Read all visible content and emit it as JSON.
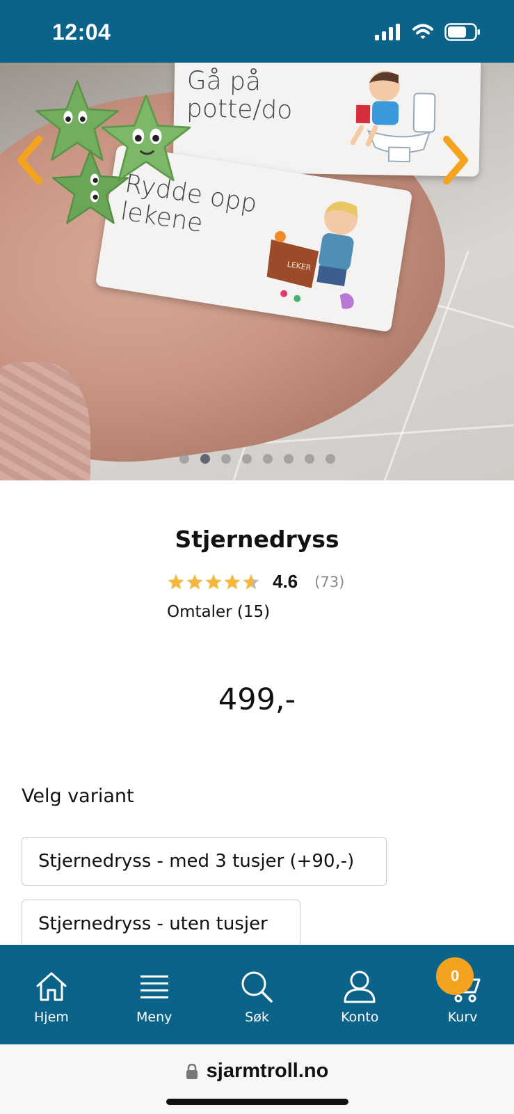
{
  "status_bar": {
    "time": "12:04"
  },
  "gallery": {
    "card_1_text": [
      "Gå på",
      "potte/do"
    ],
    "card_2_text": [
      "Rydde opp",
      "lekene"
    ],
    "box_label": "LEKER",
    "slide_count": 8,
    "active_slide": 2
  },
  "product": {
    "title": "Stjernedryss",
    "rating": "4.6",
    "rating_fraction": 0.92,
    "rating_count": "(73)",
    "reviews_link": "Omtaler (15)",
    "price": "499,-"
  },
  "variants": {
    "label": "Velg variant",
    "options": [
      "Stjernedryss - med 3 tusjer (+90,-)",
      "Stjernedryss - uten tusjer"
    ]
  },
  "bottom_nav": {
    "items": [
      {
        "label": "Hjem",
        "icon": "home-icon"
      },
      {
        "label": "Meny",
        "icon": "menu-icon"
      },
      {
        "label": "Søk",
        "icon": "search-icon"
      },
      {
        "label": "Konto",
        "icon": "account-icon"
      },
      {
        "label": "Kurv",
        "icon": "cart-icon"
      }
    ],
    "cart_count": "0"
  },
  "url_bar": {
    "domain": "sjarmtroll.no"
  },
  "colors": {
    "brand": "#0b638a",
    "accent": "#f4a31f",
    "star": "#f5b83d"
  }
}
